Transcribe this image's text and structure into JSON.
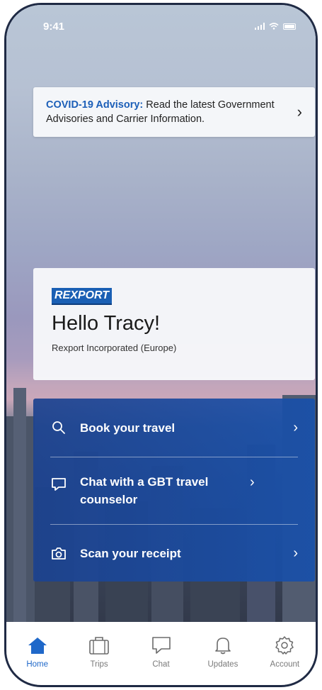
{
  "status_bar": {
    "time": "9:41"
  },
  "advisory": {
    "title": "COVID-19 Advisory:",
    "text": " Read the latest Government Advisories and Carrier Information."
  },
  "welcome": {
    "logo_text": "REXPORT",
    "greeting": "Hello Tracy!",
    "company": "Rexport Incorporated (Europe)"
  },
  "actions": [
    {
      "label": "Book your travel",
      "icon": "search-icon"
    },
    {
      "label": "Chat with a GBT travel counselor",
      "icon": "chat-icon"
    },
    {
      "label": "Scan your receipt",
      "icon": "camera-icon"
    }
  ],
  "tabs": [
    {
      "label": "Home",
      "icon": "home-icon",
      "active": true
    },
    {
      "label": "Trips",
      "icon": "suitcase-icon",
      "active": false
    },
    {
      "label": "Chat",
      "icon": "chat-icon",
      "active": false
    },
    {
      "label": "Updates",
      "icon": "bell-icon",
      "active": false
    },
    {
      "label": "Account",
      "icon": "gear-icon",
      "active": false
    }
  ],
  "colors": {
    "accent": "#1f68c9",
    "advisory_title": "#1c5fb8",
    "panel": "#1c428f",
    "logo_bg": "#1a5fb4"
  }
}
